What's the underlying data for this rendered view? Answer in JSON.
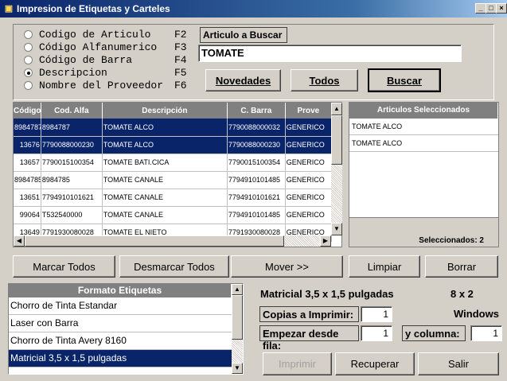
{
  "window": {
    "title": "Impresion de Etiquetas y Carteles",
    "min": "_",
    "max": "□",
    "close": "×"
  },
  "search": {
    "options": [
      {
        "label": "Codigo de Articulo",
        "key": "F2",
        "checked": false
      },
      {
        "label": "Código Alfanumerico",
        "key": "F3",
        "checked": false
      },
      {
        "label": "Código de Barra",
        "key": "F4",
        "checked": false
      },
      {
        "label": "Descripcion",
        "key": "F5",
        "checked": true
      },
      {
        "label": "Nombre del Proveedor",
        "key": "F6",
        "checked": false
      }
    ],
    "field_label": "Articulo a Buscar",
    "value": "TOMATE",
    "btn_novedades": "Novedades",
    "btn_todos": "Todos",
    "btn_buscar": "Buscar"
  },
  "grid": {
    "columns": [
      "Código",
      "Cod. Alfa",
      "Descripción",
      "C. Barra",
      "Prove"
    ],
    "rows": [
      [
        "8984787",
        "8984787",
        "TOMATE ALCO",
        "7790088000032",
        "GENERICO"
      ],
      [
        "13676",
        "7790088000230",
        "TOMATE ALCO",
        "7790088000230",
        "GENERICO"
      ],
      [
        "13657",
        "7790015100354",
        "TOMATE BATI.CICA",
        "7790015100354",
        "GENERICO"
      ],
      [
        "8984785",
        "8984785",
        "TOMATE CANALE",
        "7794910101485",
        "GENERICO"
      ],
      [
        "13651",
        "7794910101621",
        "TOMATE CANALE",
        "7794910101621",
        "GENERICO"
      ],
      [
        "99064",
        "T532540000",
        "TOMATE CANALE",
        "7794910101485",
        "GENERICO"
      ],
      [
        "13649",
        "7791930080028",
        "TOMATE EL NIETO",
        "7791930080028",
        "GENERICO"
      ]
    ],
    "selected_rows": [
      0,
      1
    ]
  },
  "selected": {
    "header": "Articulos Seleccionados",
    "items": [
      "TOMATE ALCO",
      "TOMATE ALCO"
    ],
    "count_label": "Seleccionados: 2"
  },
  "actions": {
    "marcar": "Marcar Todos",
    "desmarcar": "Desmarcar Todos",
    "mover": "Mover >>",
    "limpiar": "Limpiar",
    "borrar": "Borrar"
  },
  "formats": {
    "header": "Formato Etiquetas",
    "items": [
      "Chorro de Tinta Estandar",
      "Laser con Barra",
      "Chorro de Tinta Avery 8160",
      "Matricial 3,5 x 1,5 pulgadas"
    ],
    "selected_index": 3
  },
  "print": {
    "format_name": "Matricial 3,5 x 1,5 pulgadas",
    "dims": "8  x  2",
    "copies_label": "Copias a Imprimir:",
    "copies": "1",
    "os": "Windows",
    "row_label": "Empezar desde fila:",
    "row": "1",
    "col_label": "y columna:",
    "col": "1",
    "btn_imprimir": "Imprimir",
    "btn_recuperar": "Recuperar",
    "btn_salir": "Salir"
  }
}
